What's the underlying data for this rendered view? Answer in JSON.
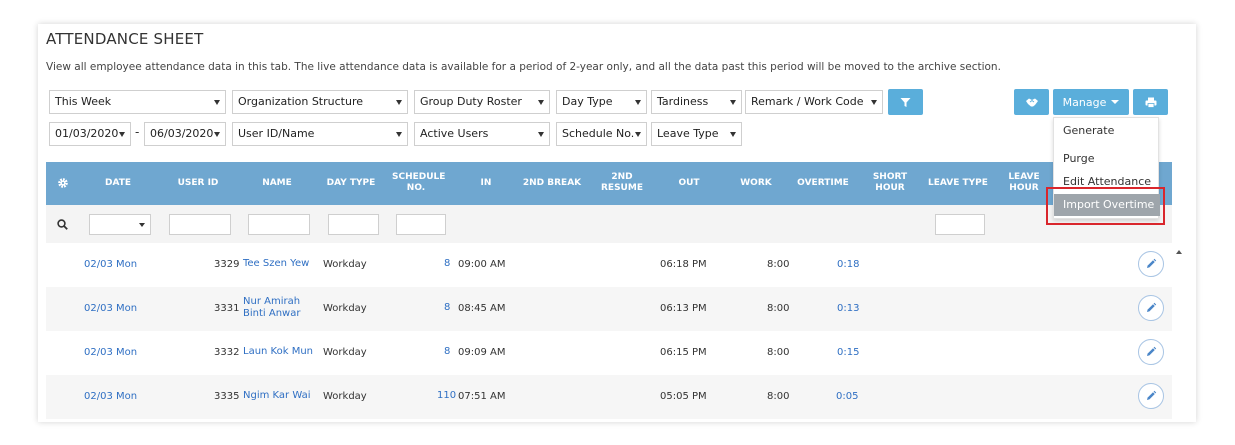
{
  "header": {
    "title": "ATTENDANCE SHEET",
    "description": "View all employee attendance data in this tab. The live attendance data is available for a period of 2-year only, and all the data past this period will be moved to the archive section."
  },
  "filters": {
    "period": "This Week",
    "org_structure": "Organization Structure",
    "group_duty_roster": "Group Duty Roster",
    "day_type": "Day Type",
    "tardiness": "Tardiness",
    "remark": "Remark / Work Code",
    "date_from": "01/03/2020",
    "date_to": "06/03/2020",
    "date_separator": "-",
    "user": "User ID/Name",
    "active_users": "Active Users",
    "schedule_no": "Schedule No.",
    "leave_type": "Leave Type"
  },
  "toolbar": {
    "manage_label": "Manage",
    "icons": [
      "filter-icon",
      "handshake-icon",
      "print-icon",
      "caret-down-icon"
    ]
  },
  "manage_menu": {
    "items": [
      "Generate",
      "Purge",
      "Edit Attendance",
      "Import Overtime"
    ],
    "highlighted": "Import Overtime",
    "highlight_color": "#d9262c"
  },
  "table": {
    "header_color": "#6fa7d0",
    "columns": [
      "DATE",
      "USER ID",
      "NAME",
      "DAY TYPE",
      "SCHEDULE NO.",
      "IN",
      "2ND BREAK",
      "2ND RESUME",
      "OUT",
      "WORK",
      "OVERTIME",
      "SHORT HOUR",
      "LEAVE TYPE",
      "LEAVE HOUR"
    ],
    "rows": [
      {
        "date": "02/03 Mon",
        "user_id": "3329",
        "name": "Tee Szen Yew",
        "day_type": "Workday",
        "schedule": "8",
        "in": "09:00 AM",
        "out": "06:18 PM",
        "work": "8:00",
        "overtime": "0:18"
      },
      {
        "date": "02/03 Mon",
        "user_id": "3331",
        "name": "Nur Amirah Binti Anwar",
        "day_type": "Workday",
        "schedule": "8",
        "in": "08:45 AM",
        "out": "06:13 PM",
        "work": "8:00",
        "overtime": "0:13"
      },
      {
        "date": "02/03 Mon",
        "user_id": "3332",
        "name": "Laun Kok Mun",
        "day_type": "Workday",
        "schedule": "8",
        "in": "09:09 AM",
        "out": "06:15 PM",
        "work": "8:00",
        "overtime": "0:15"
      },
      {
        "date": "02/03 Mon",
        "user_id": "3335",
        "name": "Ngim Kar Wai",
        "day_type": "Workday",
        "schedule": "110",
        "in": "07:51 AM",
        "out": "05:05 PM",
        "work": "8:00",
        "overtime": "0:05"
      }
    ]
  },
  "colors": {
    "accent": "#5aaedb",
    "link": "#2f6fc3"
  }
}
